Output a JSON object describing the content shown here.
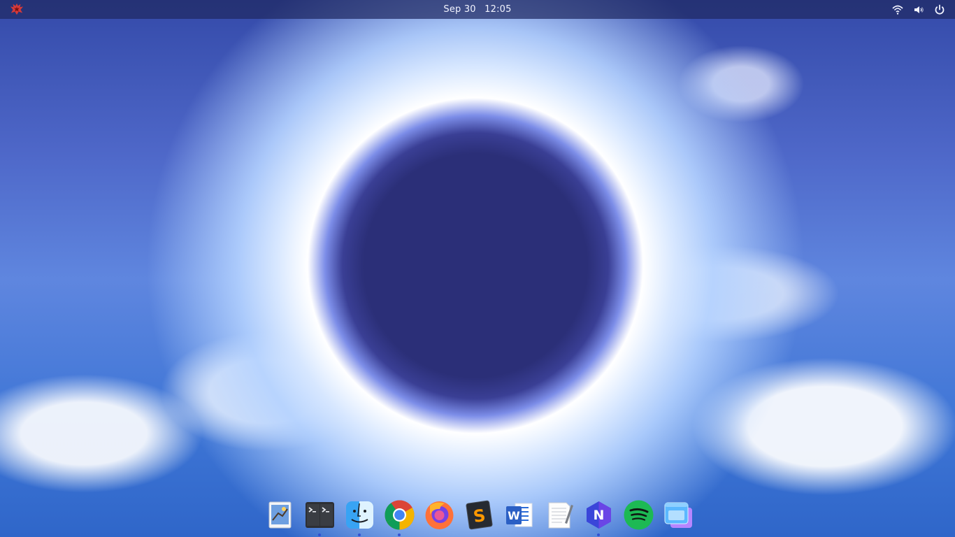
{
  "topbar": {
    "date": "Sep 30",
    "time": "12:05",
    "logo_icon": "red-wolf-logo-icon",
    "tray": [
      {
        "name": "wifi-icon"
      },
      {
        "name": "volume-icon"
      },
      {
        "name": "power-icon"
      }
    ]
  },
  "colors": {
    "topbar_bg": "#202a62",
    "topbar_text": "#f2f4ff",
    "running_indicator": "#2c4ad2"
  },
  "dock": {
    "apps": [
      {
        "name": "mail-app-icon",
        "running": false
      },
      {
        "name": "terminal-app-icon",
        "running": true
      },
      {
        "name": "finder-app-icon",
        "running": true
      },
      {
        "name": "chrome-app-icon",
        "running": true
      },
      {
        "name": "firefox-app-icon",
        "running": false
      },
      {
        "name": "sublime-text-app-icon",
        "running": false
      },
      {
        "name": "word-app-icon",
        "running": false
      },
      {
        "name": "text-editor-app-icon",
        "running": false
      },
      {
        "name": "onenote-app-icon",
        "running": true
      },
      {
        "name": "spotify-app-icon",
        "running": false
      },
      {
        "name": "window-manager-app-icon",
        "running": false
      }
    ]
  }
}
